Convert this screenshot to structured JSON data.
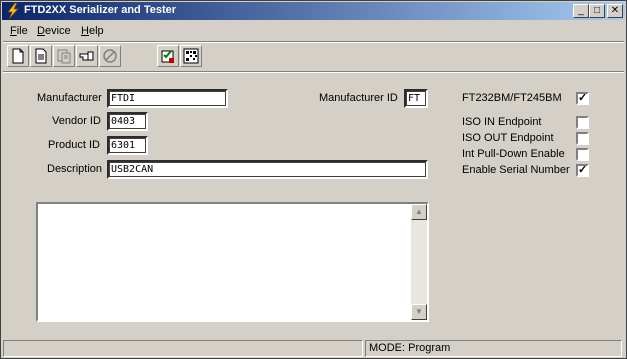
{
  "window": {
    "title": "FTD2XX Serializer and Tester"
  },
  "title_buttons": {
    "minimize": "_",
    "maximize": "□",
    "close": "✕"
  },
  "menu": [
    {
      "label": "File",
      "underline": "F",
      "rest": "ile"
    },
    {
      "label": "Device",
      "underline": "D",
      "rest": "evice"
    },
    {
      "label": "Help",
      "underline": "H",
      "rest": "elp"
    }
  ],
  "toolbar": [
    "new-file-icon",
    "document-icon",
    "program-icon",
    "pointing-hand-icon",
    "stop-icon",
    "checklist-icon",
    "barcode-icon"
  ],
  "form": {
    "manufacturer_label": "Manufacturer",
    "manufacturer_value": "FTDI",
    "vendor_id_label": "Vendor ID",
    "vendor_id_value": "0403",
    "product_id_label": "Product ID",
    "product_id_value": "6301",
    "description_label": "Description",
    "description_value": "USB2CAN",
    "manufacturer_id_label": "Manufacturer ID",
    "manufacturer_id_value": "FT"
  },
  "options": [
    {
      "label": "FT232BM/FT245BM",
      "checked": true
    },
    {
      "label": "ISO IN Endpoint",
      "checked": false
    },
    {
      "label": "ISO OUT Endpoint",
      "checked": false
    },
    {
      "label": "Int Pull-Down Enable",
      "checked": false
    },
    {
      "label": "Enable Serial Number",
      "checked": true
    }
  ],
  "log_text": "",
  "status": {
    "mode": "MODE: Program"
  },
  "colors": {
    "titlebar_start": "#0a246a",
    "titlebar_end": "#a6caf0",
    "face": "#d4d0c8"
  }
}
